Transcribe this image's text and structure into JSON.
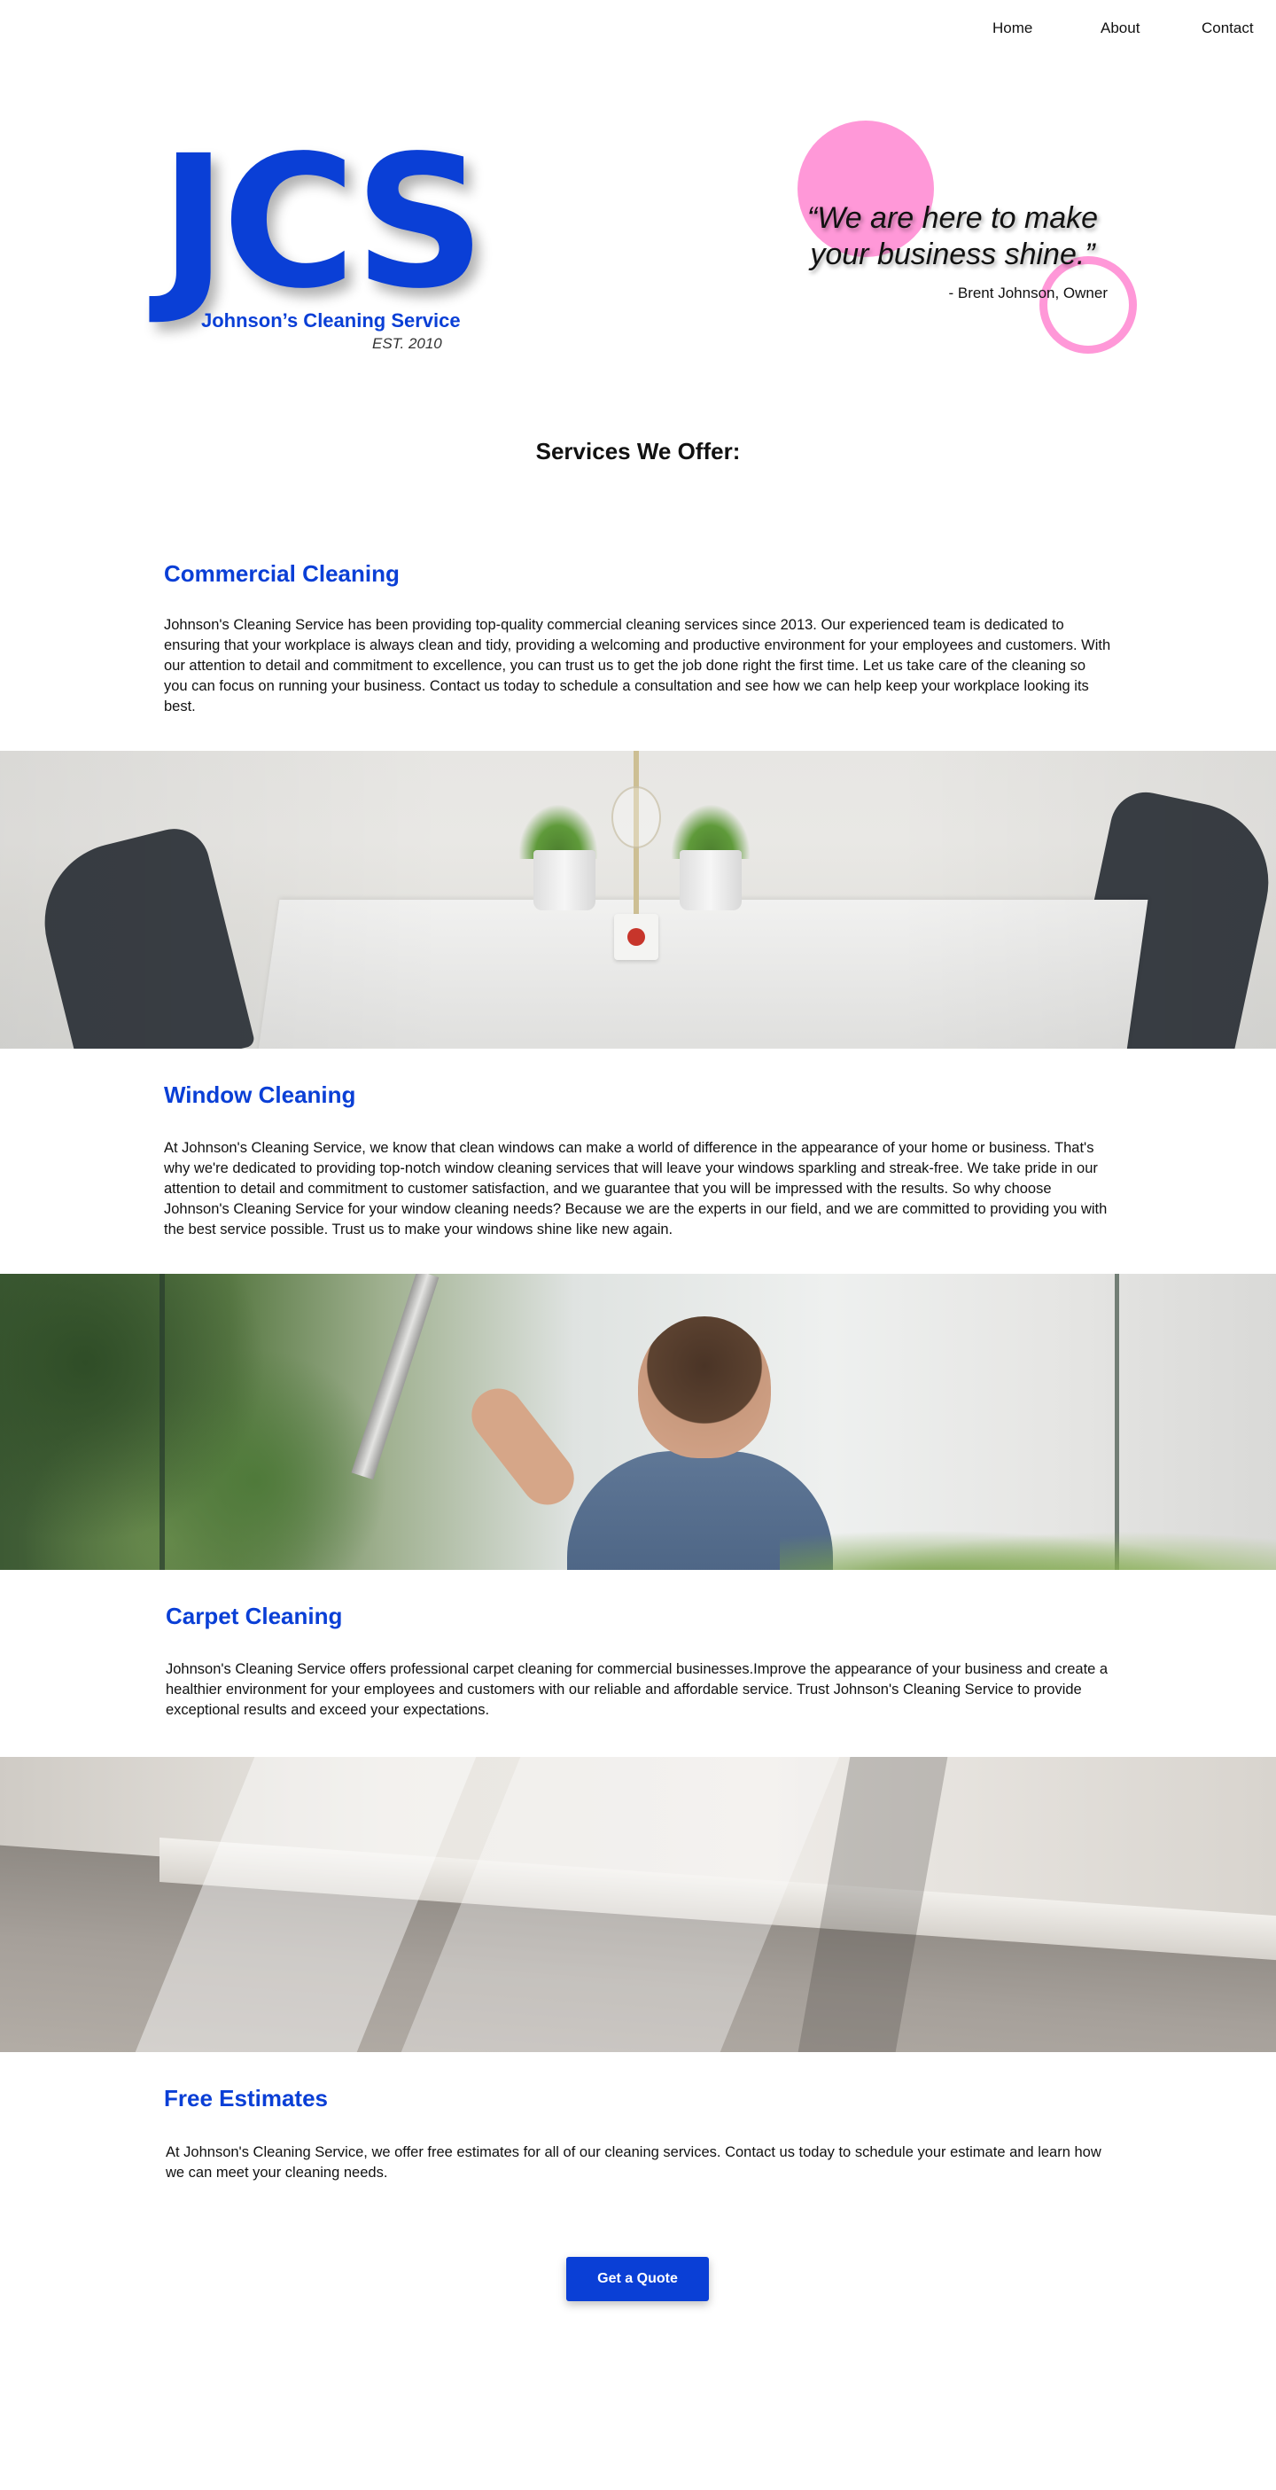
{
  "nav": {
    "home": "Home",
    "about": "About",
    "contact": "Contact"
  },
  "logo": {
    "mark": "JCS",
    "name": "Johnson’s Cleaning Service",
    "est": "EST. 2010"
  },
  "hero": {
    "quote": "“We are here to make your business shine.”",
    "author": "- Brent Johnson, Owner"
  },
  "services_title": "Services We Offer:",
  "services": [
    {
      "title": "Commercial Cleaning",
      "body": "Johnson's Cleaning Service has been providing top-quality commercial cleaning services since 2013. Our experienced team is dedicated to ensuring that your workplace is always clean and tidy, providing a welcoming and productive environment for your employees and customers. With our attention to detail and commitment to excellence, you can trust us to get the job done right the first time. Let us take care of the cleaning so you can focus on running your business. Contact us today to schedule a consultation and see how we can help keep your workplace looking its best."
    },
    {
      "title": "Window Cleaning",
      "body": "At Johnson's Cleaning Service, we know that clean windows can make a world of difference in the appearance of your home or business. That's why we're dedicated to providing top-notch window cleaning services that will leave your windows sparkling and streak-free. We take pride in our attention to detail and commitment to customer satisfaction, and we guarantee that you will be impressed with the results. So why choose Johnson's Cleaning Service for your window cleaning needs? Because we are the experts in our field, and we are committed to providing you with the best service possible. Trust us to make your windows shine like new again."
    },
    {
      "title": "Carpet Cleaning",
      "body": "Johnson's Cleaning Service offers professional carpet cleaning for commercial businesses.Improve the appearance of your business and create a healthier environment for your employees and customers with our reliable and affordable service. Trust Johnson's Cleaning Service to provide exceptional results and exceed your expectations."
    },
    {
      "title": "Free Estimates",
      "body": "At Johnson's Cleaning Service, we offer free estimates for all of our cleaning services. Contact us today to schedule your estimate and learn how we can meet your cleaning needs."
    }
  ],
  "cta": {
    "label": "Get a  Quote"
  },
  "colors": {
    "brand_blue": "#0a3fd6",
    "accent_pink": "#ff98d8"
  }
}
